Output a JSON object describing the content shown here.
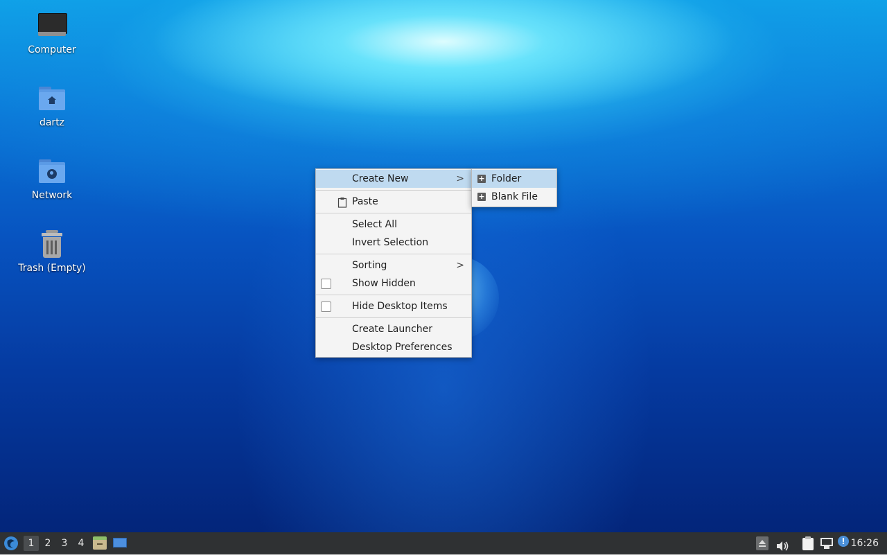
{
  "desktop": {
    "icons": [
      {
        "label": "Computer",
        "icon": "monitor-icon"
      },
      {
        "label": "dartz",
        "icon": "home-folder-icon"
      },
      {
        "label": "Network",
        "icon": "network-folder-icon"
      },
      {
        "label": "Trash (Empty)",
        "icon": "trash-icon"
      }
    ]
  },
  "context_menu": {
    "items": [
      {
        "label": "Create New",
        "has_submenu": true,
        "highlighted": true
      },
      {
        "label": "Paste",
        "icon": "clipboard-icon"
      },
      {
        "label": "Select All"
      },
      {
        "label": "Invert Selection"
      },
      {
        "label": "Sorting",
        "has_submenu": true
      },
      {
        "label": "Show Hidden",
        "checkbox": false
      },
      {
        "label": "Hide Desktop Items",
        "checkbox": false
      },
      {
        "label": "Create Launcher"
      },
      {
        "label": "Desktop Preferences"
      }
    ],
    "arrow": ">"
  },
  "submenu": {
    "items": [
      {
        "label": "Folder",
        "icon": "new-folder-icon",
        "highlighted": true
      },
      {
        "label": "Blank File",
        "icon": "new-file-icon"
      }
    ]
  },
  "taskbar": {
    "workspaces": [
      "1",
      "2",
      "3",
      "4"
    ],
    "active_workspace": "1",
    "clock": "16:26",
    "tray_icons": [
      "eject-icon",
      "volume-icon",
      "clipboard-icon",
      "network-icon",
      "notification-icon"
    ],
    "launchers": [
      "start-menu-icon",
      "file-manager-icon",
      "show-desktop-icon"
    ]
  },
  "colors": {
    "menu_highlight": "#bfdaf0",
    "taskbar_bg": "#2f3133"
  }
}
